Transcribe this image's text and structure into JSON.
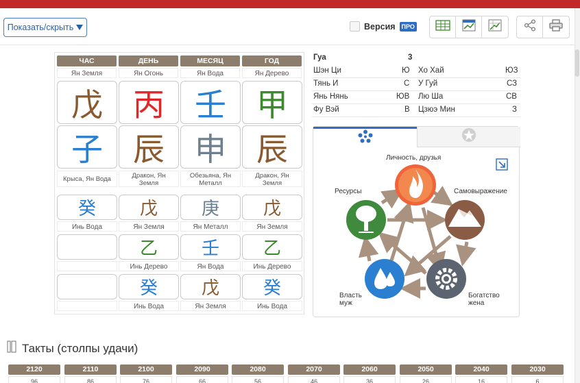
{
  "colors": {
    "accent": "#2e6fc4",
    "header_brown": "#8c7d6c",
    "earth": "#8a5a2e",
    "fire": "#e02626",
    "water": "#2b7fd1",
    "wood": "#3d8a2e",
    "metal": "#6e7f8f"
  },
  "toolbar": {
    "toggle_label": "Показать/скрыть",
    "toggle_icon": "triangle-down-icon",
    "version_label": "Версия",
    "pro_badge": "ПРО"
  },
  "pillars": {
    "headers": [
      "ЧАС",
      "ДЕНЬ",
      "МЕСЯЦ",
      "ГОД"
    ],
    "stem_labels": [
      "Ян Земля",
      "Ян Огонь",
      "Ян Вода",
      "Ян Дерево"
    ],
    "stems": [
      {
        "char": "戊",
        "element": "earth"
      },
      {
        "char": "丙",
        "element": "fire"
      },
      {
        "char": "壬",
        "element": "water"
      },
      {
        "char": "甲",
        "element": "wood"
      }
    ],
    "branches": [
      {
        "char": "子",
        "element": "water"
      },
      {
        "char": "辰",
        "element": "earth"
      },
      {
        "char": "申",
        "element": "metal"
      },
      {
        "char": "辰",
        "element": "earth"
      }
    ],
    "branch_labels": [
      [
        "Крыса, Ян Вода"
      ],
      [
        "Дракон, Ян",
        "Земля"
      ],
      [
        "Обезьяна, Ян",
        "Металл"
      ],
      [
        "Дракон, Ян",
        "Земля"
      ]
    ],
    "hidden": [
      [
        {
          "char": "癸",
          "element": "water",
          "label": "Инь Вода"
        },
        {
          "char": "戊",
          "element": "earth",
          "label": "Ян Земля"
        },
        {
          "char": "庚",
          "element": "metal",
          "label": "Ян Металл"
        },
        {
          "char": "戊",
          "element": "earth",
          "label": "Ян Земля"
        }
      ],
      [
        null,
        {
          "char": "乙",
          "element": "wood",
          "label": "Инь Дерево"
        },
        {
          "char": "壬",
          "element": "water",
          "label": "Ян Вода"
        },
        {
          "char": "乙",
          "element": "wood",
          "label": "Инь Дерево"
        }
      ],
      [
        null,
        {
          "char": "癸",
          "element": "water",
          "label": "Инь Вода"
        },
        {
          "char": "戊",
          "element": "earth",
          "label": "Ян Земля"
        },
        {
          "char": "癸",
          "element": "water",
          "label": "Инь Вода"
        }
      ]
    ]
  },
  "gua": {
    "label": "Гуа",
    "value": "3",
    "rows": [
      {
        "l_name": "Шэн Ци",
        "l_val": "Ю",
        "r_name": "Хо Хай",
        "r_val": "ЮЗ"
      },
      {
        "l_name": "Тянь И",
        "l_val": "С",
        "r_name": "У Гуй",
        "r_val": "СЗ"
      },
      {
        "l_name": "Янь Нянь",
        "l_val": "ЮВ",
        "r_name": "Лю Ша",
        "r_val": "СВ"
      },
      {
        "l_name": "Фу Вэй",
        "l_val": "В",
        "r_name": "Цзюэ Мин",
        "r_val": "З"
      }
    ]
  },
  "elements_panel": {
    "tab_active_icon": "five-elements-icon",
    "tab_inactive_icon": "star-circle-icon",
    "labels": {
      "fire": "Личность, друзья",
      "wood": "Ресурсы",
      "earth": "Самовыражение",
      "water_1": "Власть",
      "water_2": "муж",
      "metal_1": "Богатство",
      "metal_2": "жена"
    }
  },
  "luck": {
    "title": "Такты (столпы удачи)",
    "years": [
      "2120",
      "2110",
      "2100",
      "2090",
      "2080",
      "2070",
      "2060",
      "2050",
      "2040",
      "2030"
    ],
    "ages": [
      "96",
      "86",
      "76",
      "66",
      "56",
      "46",
      "36",
      "26",
      "16",
      "6"
    ]
  }
}
